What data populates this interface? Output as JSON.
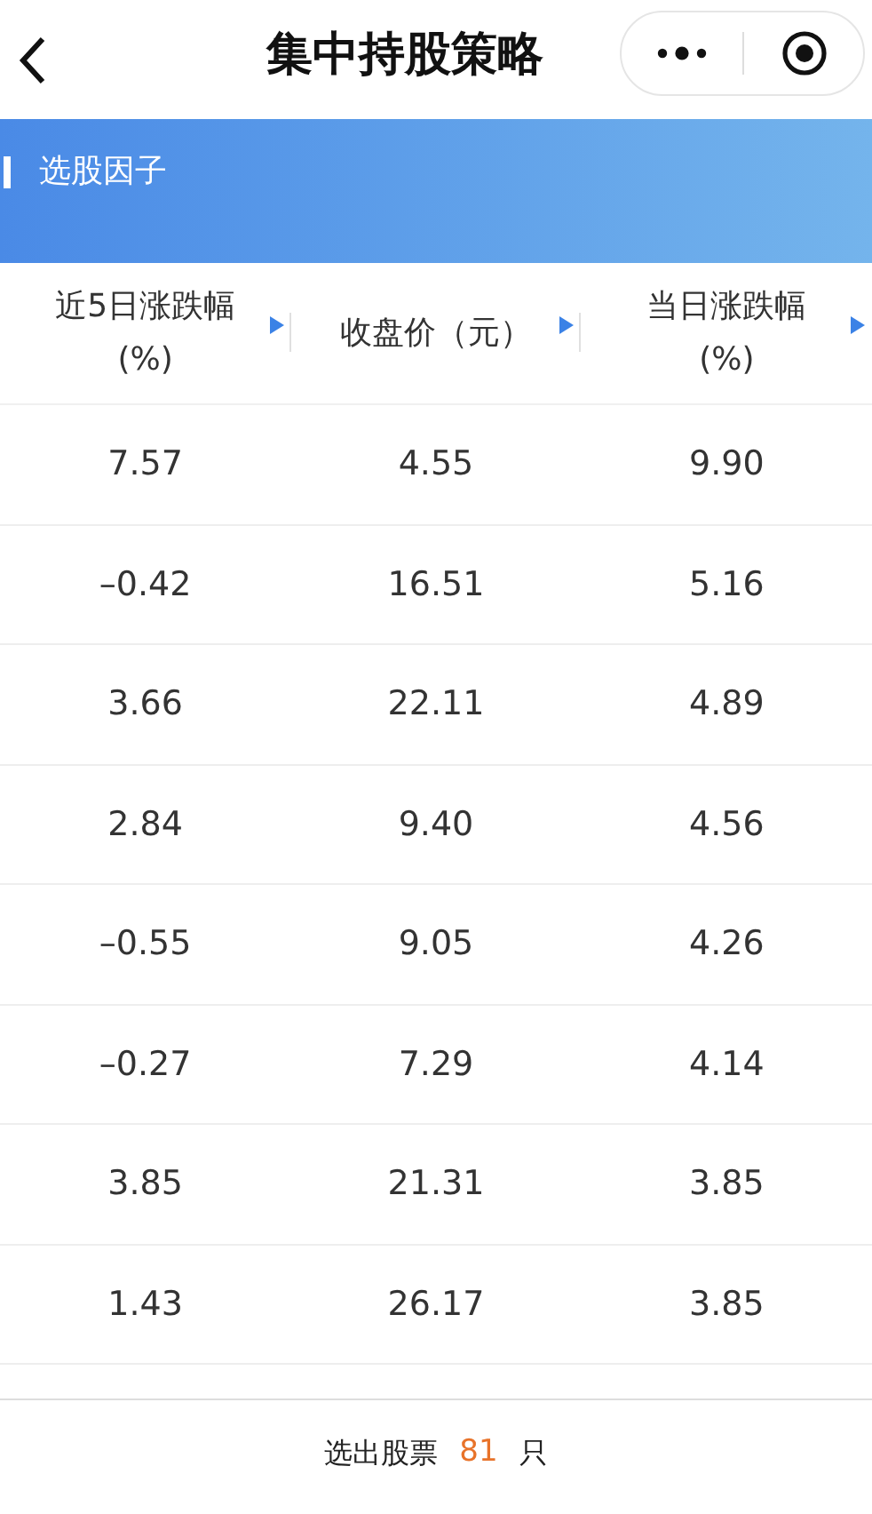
{
  "nav": {
    "title": "集中持股策略"
  },
  "banner": {
    "title": "选股因子"
  },
  "table": {
    "columns": [
      {
        "label": "近5日涨跌幅\n(%)"
      },
      {
        "label": "收盘价（元）"
      },
      {
        "label": "当日涨跌幅\n(%)"
      }
    ],
    "rows": [
      [
        "7.57",
        "4.55",
        "9.90"
      ],
      [
        "–0.42",
        "16.51",
        "5.16"
      ],
      [
        "3.66",
        "22.11",
        "4.89"
      ],
      [
        "2.84",
        "9.40",
        "4.56"
      ],
      [
        "–0.55",
        "9.05",
        "4.26"
      ],
      [
        "–0.27",
        "7.29",
        "4.14"
      ],
      [
        "3.85",
        "21.31",
        "3.85"
      ],
      [
        "1.43",
        "26.17",
        "3.85"
      ]
    ]
  },
  "footer": {
    "prefix": "选出股票",
    "count": "81",
    "suffix": "只"
  }
}
